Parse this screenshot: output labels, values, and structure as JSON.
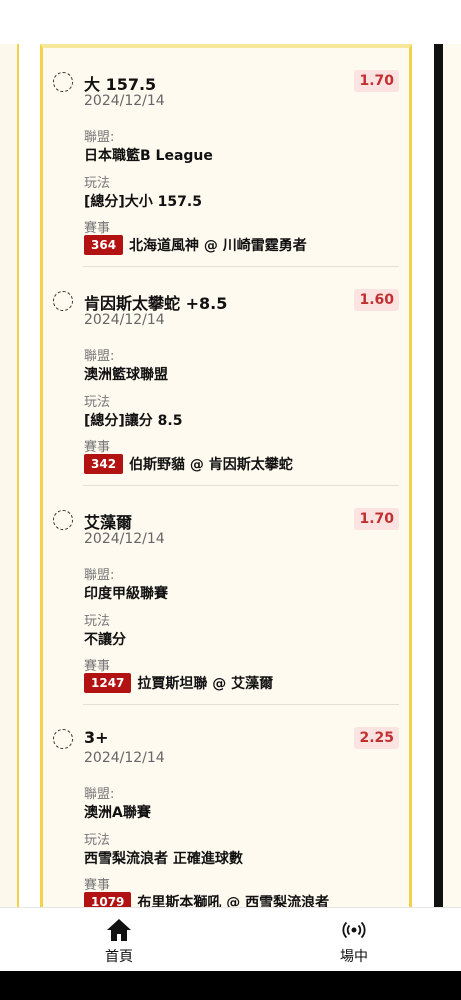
{
  "labels": {
    "league": "聯盟:",
    "play": "玩法",
    "event": "賽事"
  },
  "bets": [
    {
      "pick": "大 157.5",
      "date": "2024/12/14",
      "odds": "1.70",
      "league": "日本職籃B League",
      "play": "[總分]大小 157.5",
      "match_id": "364",
      "match": "北海道風神 @ 川崎雷霆勇者"
    },
    {
      "pick": "肯因斯太攀蛇 +8.5",
      "date": "2024/12/14",
      "odds": "1.60",
      "league": "澳洲籃球聯盟",
      "play": "[總分]讓分 8.5",
      "match_id": "342",
      "match": "伯斯野貓 @ 肯因斯太攀蛇"
    },
    {
      "pick": "艾藻爾",
      "date": "2024/12/14",
      "odds": "1.70",
      "league": "印度甲級聯賽",
      "play": "不讓分",
      "match_id": "1247",
      "match": "拉賈斯坦聯 @ 艾藻爾"
    },
    {
      "pick": "3+",
      "date": "2024/12/14",
      "odds": "2.25",
      "league": "澳洲A聯賽",
      "play": "西雪梨流浪者 正確進球數",
      "match_id": "1079",
      "match": "布里斯本獅吼 @ 西雪梨流浪者"
    }
  ],
  "nav": {
    "home": {
      "label": "首頁",
      "icon": "home-icon"
    },
    "live": {
      "label": "場中",
      "icon": "broadcast-icon"
    }
  },
  "colors": {
    "accent": "#f3d24a",
    "odds_bg": "#fbe3e1",
    "odds_text": "#c03030",
    "match_id_bg": "#b31212"
  }
}
